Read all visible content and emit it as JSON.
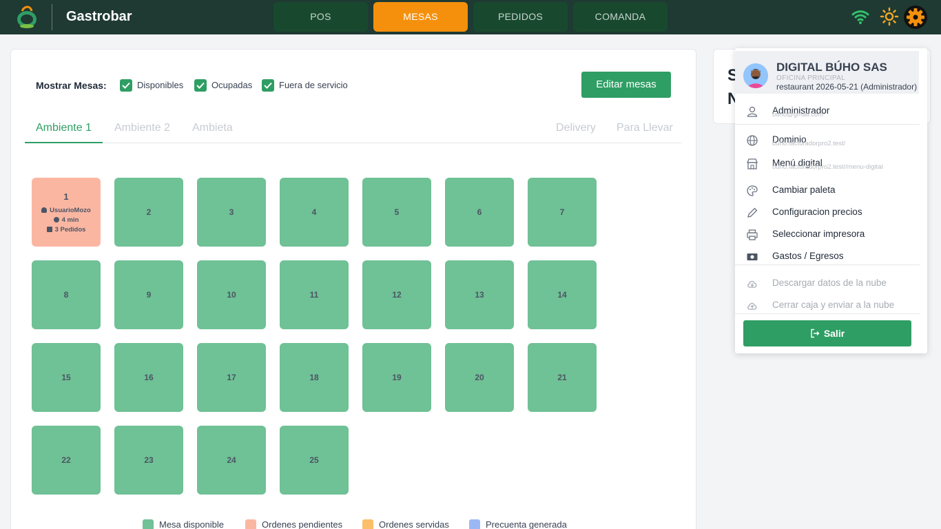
{
  "app": {
    "brand": "Gastrobar"
  },
  "nav": [
    {
      "label": "POS"
    },
    {
      "label": "MESAS"
    },
    {
      "label": "PEDIDOS"
    },
    {
      "label": "COMANDA"
    }
  ],
  "icons": {
    "wifi": "wifi-icon",
    "theme": "sun-icon",
    "settings": "gear-icon"
  },
  "colors": {
    "accent": "#2f9e64",
    "nav_active": "#f5900c",
    "table_available": "#6fc196",
    "table_pending": "#fbb6a2",
    "table_served": "#fbbf69",
    "precuenta": "#9bb8f5"
  },
  "filters": {
    "label": "Mostrar Mesas:",
    "options": [
      {
        "label": "Disponibles",
        "checked": true
      },
      {
        "label": "Ocupadas",
        "checked": true
      },
      {
        "label": "Fuera de servicio",
        "checked": true
      }
    ]
  },
  "edit_button": "Editar mesas",
  "tabs": [
    "Ambiente 1",
    "Ambiente 2",
    "Ambieta"
  ],
  "tabs_right": [
    "Delivery",
    "Para Llevar"
  ],
  "active_tab": "Ambiente 1",
  "tables": [
    {
      "number": "1",
      "status": "pending",
      "waiter": "UsuarioMozo",
      "time": "4 min",
      "orders": "3 Pedidos"
    },
    {
      "number": "2"
    },
    {
      "number": "3"
    },
    {
      "number": "4"
    },
    {
      "number": "5"
    },
    {
      "number": "6"
    },
    {
      "number": "7"
    },
    {
      "number": "8"
    },
    {
      "number": "9"
    },
    {
      "number": "10"
    },
    {
      "number": "11"
    },
    {
      "number": "12"
    },
    {
      "number": "13"
    },
    {
      "number": "14"
    },
    {
      "number": "15"
    },
    {
      "number": "16"
    },
    {
      "number": "17"
    },
    {
      "number": "18"
    },
    {
      "number": "19"
    },
    {
      "number": "20"
    },
    {
      "number": "21"
    },
    {
      "number": "22"
    },
    {
      "number": "23"
    },
    {
      "number": "24"
    },
    {
      "number": "25"
    }
  ],
  "legend": [
    {
      "label": "Mesa disponible",
      "color": "#6fc196"
    },
    {
      "label": "Ordenes pendientes",
      "color": "#fbb6a2"
    },
    {
      "label": "Ordenes servidas",
      "color": "#fbbf69"
    },
    {
      "label": "Precuenta generada",
      "color": "#9bb8f5"
    }
  ],
  "side_card": {
    "line1": "S",
    "line2": "N"
  },
  "user_menu": {
    "company": "DIGITAL BÚHO SAS",
    "branch": "OFICINA PRINCIPAL",
    "info": "restaurant 2026-05-21 (Administrador)",
    "user": {
      "label": "Administrador",
      "email": "buho@gmail.com"
    },
    "domain": {
      "label": "Dominio",
      "url": "buho.facturadorpro2.test/"
    },
    "digital_menu": {
      "label": "Menú digital",
      "url": "buho.facturadorpro2.test//menu-digital"
    },
    "palette": "Cambiar paleta",
    "prices": "Configuracion precios",
    "printer": "Seleccionar impresora",
    "expenses": "Gastos / Egresos",
    "download": "Descargar datos de la nube",
    "close_cash": "Cerrar caja y enviar a la nube",
    "logout": "Salir"
  }
}
